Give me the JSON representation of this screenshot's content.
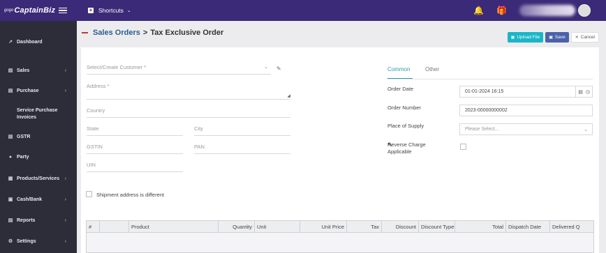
{
  "brand": {
    "prefix": "gogo",
    "name": "CaptainBiz"
  },
  "topbar": {
    "shortcuts_label": "Shortcuts",
    "bell_icon": "bell-icon",
    "gift_icon": "gift-icon"
  },
  "sidebar": {
    "items": [
      {
        "label": "Dashboard",
        "icon": "dashboard-icon",
        "has_arrow": false
      },
      {
        "label": "Sales",
        "icon": "sales-icon",
        "has_arrow": true
      },
      {
        "label": "Purchase",
        "icon": "purchase-icon",
        "has_arrow": true
      },
      {
        "label": "Service Purchase Invoices",
        "icon": "service-invoice-icon",
        "has_arrow": false
      },
      {
        "label": "GSTR",
        "icon": "gstr-icon",
        "has_arrow": false
      },
      {
        "label": "Party",
        "icon": "party-icon",
        "has_arrow": false
      },
      {
        "label": "Products/Services",
        "icon": "products-icon",
        "has_arrow": true
      },
      {
        "label": "Cash/Bank",
        "icon": "cash-bank-icon",
        "has_arrow": true
      },
      {
        "label": "Reports",
        "icon": "reports-icon",
        "has_arrow": true
      },
      {
        "label": "Settings",
        "icon": "settings-icon",
        "has_arrow": true
      }
    ]
  },
  "breadcrumb": {
    "parent": "Sales Orders",
    "separator": ">",
    "current": "Tax Exclusive Order"
  },
  "actions": {
    "upload_label": "Upload File",
    "save_label": "Save",
    "cancel_label": "Cancel"
  },
  "form": {
    "customer_placeholder": "Select/Create Customer *",
    "address_placeholder": "Address *",
    "country_placeholder": "Country",
    "state_placeholder": "State",
    "city_placeholder": "City",
    "gstin_placeholder": "GSTIN",
    "pan_placeholder": "PAN",
    "uin_placeholder": "UIN",
    "shipment_label": "Shipment address is different",
    "shipment_checked": false
  },
  "right_panel": {
    "tabs": [
      "Common",
      "Other"
    ],
    "active_tab": "Common",
    "order_date_label": "Order Date",
    "order_date_value": "01-01-2024 16:15",
    "order_number_label": "Order Number",
    "order_number_value": "2023-00000000002",
    "place_of_supply_label": "Place of Supply",
    "place_of_supply_placeholder": "Please Select...",
    "reverse_charge_label_1": "Reverse Charge",
    "reverse_charge_label_2": "Applicable",
    "reverse_charge_checked": false
  },
  "table": {
    "columns": [
      "#",
      "",
      "Product",
      "Quantity",
      "Unit",
      "Unit Price",
      "Tax",
      "Discount",
      "Discount Type",
      "Total",
      "Dispatch Date",
      "Delivered Q"
    ]
  }
}
